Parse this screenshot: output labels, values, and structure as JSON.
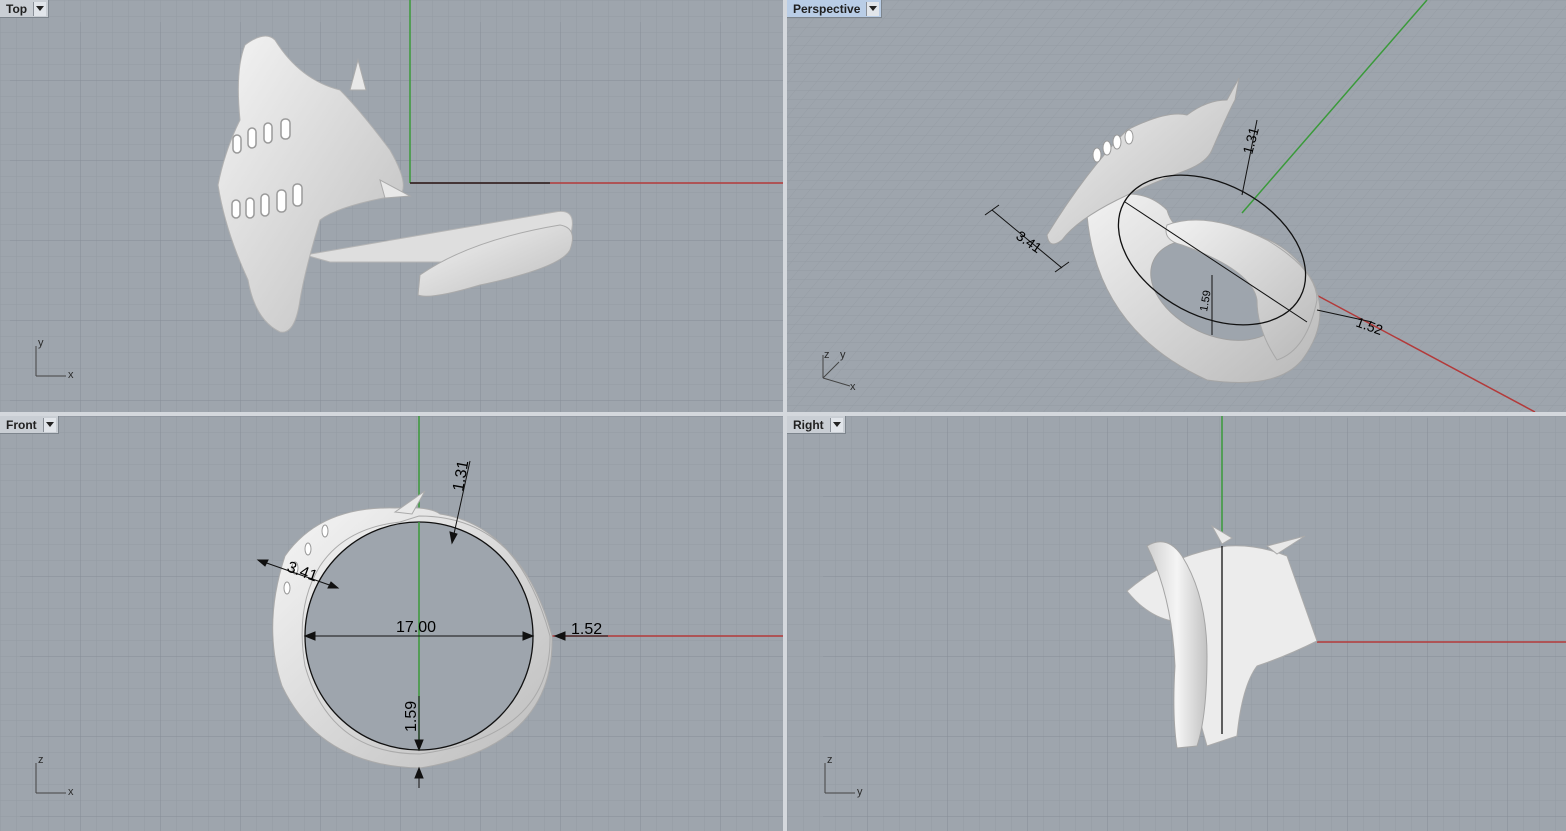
{
  "viewports": {
    "top": {
      "title": "Top",
      "axes": {
        "vertical": "y",
        "horizontal": "x"
      }
    },
    "perspective": {
      "title": "Perspective",
      "axes": {
        "a": "z",
        "b": "y",
        "c": "x"
      },
      "dimensions": {
        "thickness_top": "1.31",
        "band_width": "3.41",
        "band_bottom": "1.59",
        "band_side": "1.52"
      }
    },
    "front": {
      "title": "Front",
      "axes": {
        "vertical": "z",
        "horizontal": "x"
      },
      "dimensions": {
        "thickness_top": "1.31",
        "band_width": "3.41",
        "inner_diameter": "17.00",
        "band_side": "1.52",
        "band_bottom": "1.59"
      }
    },
    "right": {
      "title": "Right",
      "axes": {
        "vertical": "z",
        "horizontal": "y"
      }
    }
  },
  "colors": {
    "viewport_bg": "#9ea5ad",
    "grid_minor": "#949ba3",
    "grid_major": "#858c95",
    "x_axis": "#b33a3a",
    "y_axis": "#3a9a3a",
    "model": "#e6e6e6",
    "active_tab": "#b9cde6"
  },
  "icons": {
    "dropdown": "chevron-down-icon"
  }
}
